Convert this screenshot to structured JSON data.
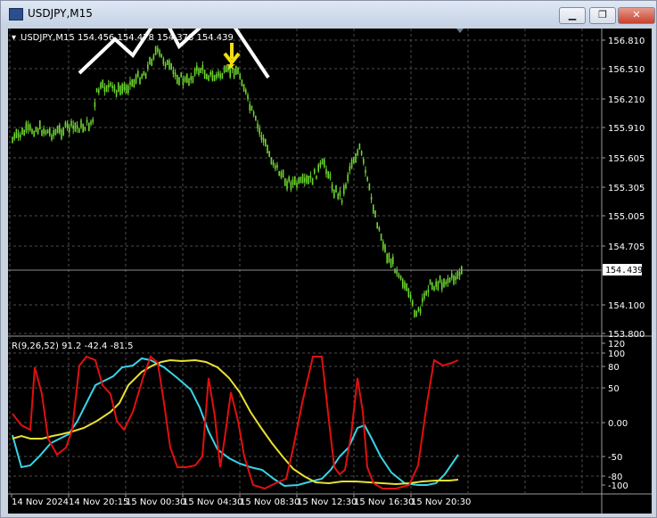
{
  "window": {
    "title": "USDJPY,M15",
    "minimize_label": "▁",
    "restore_label": "❐",
    "close_label": "✕"
  },
  "chart": {
    "header": "USDJPY,M15  154.456 154.478 154.378 154.439",
    "current_price": "154.439",
    "price_ticks": [
      "156.810",
      "156.510",
      "156.210",
      "155.910",
      "155.605",
      "155.305",
      "155.005",
      "154.705",
      "154.100",
      "153.800"
    ],
    "indicator_header": "R(9,26,52) 91.2 -42.4 -81.5",
    "indicator_ticks": [
      "120",
      "100",
      "80",
      "50",
      "0.00",
      "-50",
      "-80",
      "-100"
    ],
    "time_labels": [
      "14 Nov 2024",
      "14 Nov 20:15",
      "15 Nov 00:30",
      "15 Nov 04:30",
      "15 Nov 08:30",
      "15 Nov 12:30",
      "15 Nov 16:30",
      "15 Nov 20:30"
    ],
    "colors": {
      "background": "#000000",
      "candle": "#6bd52e",
      "grid": "#4b4b4b",
      "fast_line": "#e01010",
      "mid_line": "#39d4e8",
      "slow_line": "#e8e033",
      "marker": "#f0e010",
      "pattern": "#ffffff"
    }
  }
}
